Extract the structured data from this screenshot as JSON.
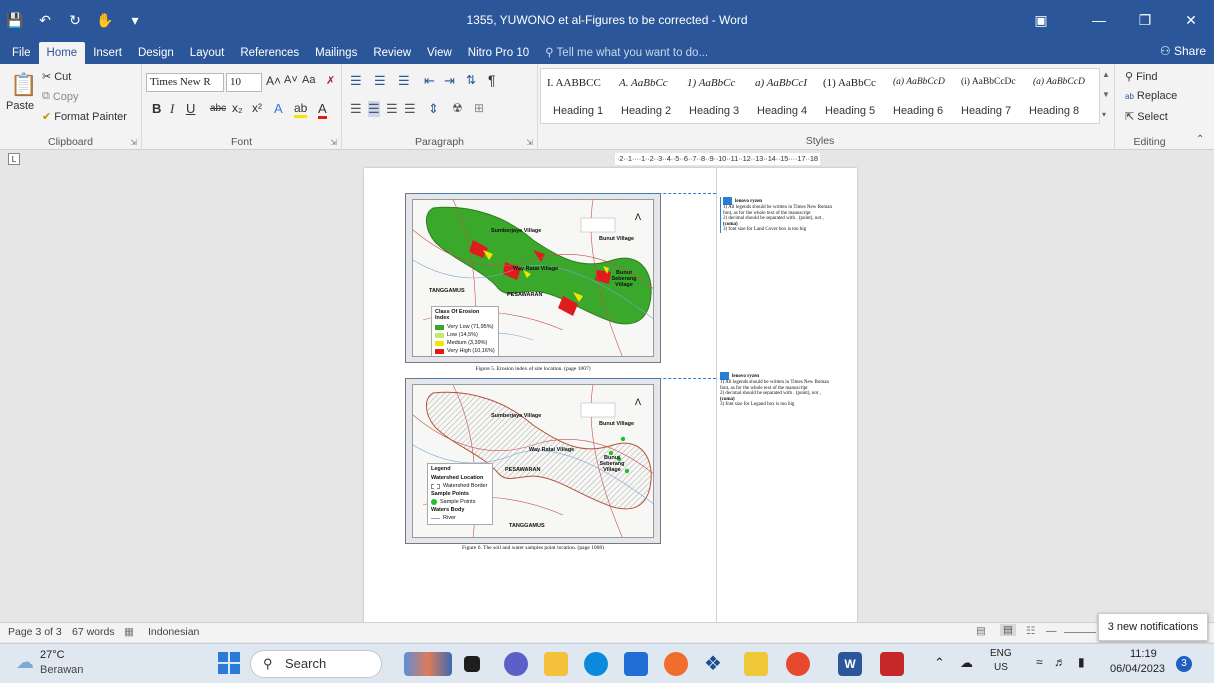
{
  "window": {
    "title": "1355, YUWONO et al-Figures to be corrected - Word"
  },
  "tabs": [
    "File",
    "Home",
    "Insert",
    "Design",
    "Layout",
    "References",
    "Mailings",
    "Review",
    "View",
    "Nitro Pro 10"
  ],
  "tell_me": "Tell me what you want to do...",
  "share": "Share",
  "clipboard": {
    "paste": "Paste",
    "cut": "Cut",
    "copy": "Copy",
    "format_painter": "Format Painter",
    "label": "Clipboard"
  },
  "font": {
    "name": "Times New R",
    "size": "10",
    "label": "Font",
    "bold": "B",
    "italic": "I",
    "underline": "U",
    "strike": "abc",
    "sub": "x₂",
    "sup": "x²",
    "grow": "A˄",
    "shrink": "A˅",
    "case": "Aa"
  },
  "paragraph": {
    "label": "Paragraph",
    "pilcrow": "¶"
  },
  "styles": {
    "label": "Styles",
    "samples": [
      "I. AABBCC",
      "A. AaBbCc",
      "1) AaBbCc",
      "a) AaBbCcI",
      "(1) AaBbCc",
      "(a) AaBbCcD",
      "(i) AaBbCcDc",
      "(a) AaBbCcD"
    ],
    "names": [
      "Heading 1",
      "Heading 2",
      "Heading 3",
      "Heading 4",
      "Heading 5",
      "Heading 6",
      "Heading 7",
      "Heading 8"
    ]
  },
  "editing": {
    "label": "Editing",
    "find": "Find",
    "replace": "Replace",
    "select": "Select"
  },
  "ruler": "·2··1····1··2··3··4··5··6··7··8··9··10··11··12··13··14··15····17··18",
  "comments": [
    {
      "author": "lenovo ryzen",
      "lines": [
        "1) All legends should be written in Times New Roman",
        "font, as for the whole text of the manuscript",
        "2) decimal should be separated with . (point), not ,",
        "(coma)",
        "3) font size for Land Cover box is too big"
      ]
    },
    {
      "author": "lenovo ryzen",
      "lines": [
        "1) All legends should be written in Times New Roman",
        "font, as for the whole text of the manuscript",
        "2) decimal should be separated with . (point), not ,",
        "(coma)",
        "3) font size for Legand box is too big"
      ]
    }
  ],
  "figure5": {
    "caption": "Figure 5. Erosion index of site location. (page 1007)",
    "labels": [
      "Sumberjaya Village",
      "Bunut Village",
      "Way Ratai Village",
      "Bunut Seberang Village",
      "TANGGAMUS",
      "PESAWARAN"
    ],
    "legend_title": "Class Of Erosion Index",
    "legend": [
      {
        "label": "Very Low (71,95%)",
        "color": "#3aa82a"
      },
      {
        "label": "Low (14,5%)",
        "color": "#c8e86b"
      },
      {
        "label": "Medium (3,39%)",
        "color": "#f2e600"
      },
      {
        "label": "Very High (10,16%)",
        "color": "#e01b1b"
      }
    ]
  },
  "figure6": {
    "caption": "Figure 6. The soil and water samples point location. (page 1008)",
    "labels": [
      "Sumberjaya Village",
      "Bunut Village",
      "Way Ratai Village",
      "Bunut Seberang Village",
      "PESAWARAN",
      "TANGGAMUS"
    ],
    "legend_title": "Legend",
    "legend": [
      "Watershed Location",
      "Watershed Border",
      "Sample Points",
      "Sample Points",
      "Waters Body",
      "River"
    ]
  },
  "statusbar": {
    "page": "Page 3 of 3",
    "words": "67 words",
    "language": "Indonesian"
  },
  "notification": "3 new notifications",
  "taskbar": {
    "weather_temp": "27°C",
    "weather_desc": "Berawan",
    "search": "Search",
    "lang1": "ENG",
    "lang2": "US",
    "time": "11:19",
    "date": "06/04/2023",
    "badge": "3"
  }
}
